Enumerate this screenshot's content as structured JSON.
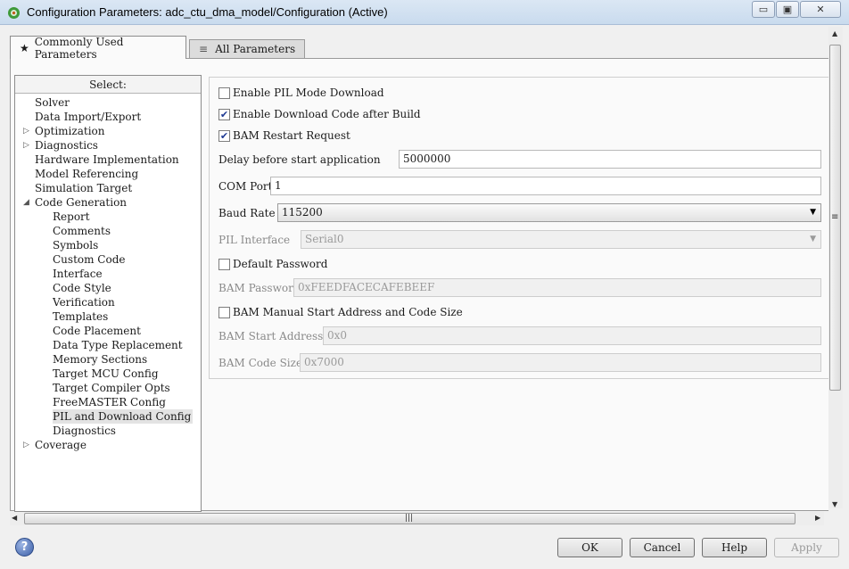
{
  "window": {
    "title": "Configuration Parameters: adc_ctu_dma_model/Configuration (Active)",
    "minimize": "▭",
    "maximize": "▣",
    "close": "✕"
  },
  "tabs": [
    {
      "icon": "★",
      "label": "Commonly Used Parameters"
    },
    {
      "icon": "≡",
      "label": "All Parameters"
    }
  ],
  "tree": {
    "header": "Select:",
    "items": [
      {
        "label": "Solver",
        "level": 0
      },
      {
        "label": "Data Import/Export",
        "level": 0
      },
      {
        "label": "Optimization",
        "level": 0,
        "expander": "▷"
      },
      {
        "label": "Diagnostics",
        "level": 0,
        "expander": "▷"
      },
      {
        "label": "Hardware Implementation",
        "level": 0
      },
      {
        "label": "Model Referencing",
        "level": 0
      },
      {
        "label": "Simulation Target",
        "level": 0
      },
      {
        "label": "Code Generation",
        "level": 0,
        "expander": "◢"
      },
      {
        "label": "Report",
        "level": 1
      },
      {
        "label": "Comments",
        "level": 1
      },
      {
        "label": "Symbols",
        "level": 1
      },
      {
        "label": "Custom Code",
        "level": 1
      },
      {
        "label": "Interface",
        "level": 1
      },
      {
        "label": "Code Style",
        "level": 1
      },
      {
        "label": "Verification",
        "level": 1
      },
      {
        "label": "Templates",
        "level": 1
      },
      {
        "label": "Code Placement",
        "level": 1
      },
      {
        "label": "Data Type Replacement",
        "level": 1
      },
      {
        "label": "Memory Sections",
        "level": 1
      },
      {
        "label": "Target MCU Config",
        "level": 1
      },
      {
        "label": "Target Compiler Opts",
        "level": 1
      },
      {
        "label": "FreeMASTER Config",
        "level": 1
      },
      {
        "label": "PIL and Download Config",
        "level": 1,
        "selected": true
      },
      {
        "label": "Diagnostics",
        "level": 1
      },
      {
        "label": "Coverage",
        "level": 0,
        "expander": "▷"
      }
    ]
  },
  "settings": {
    "enable_pil": {
      "label": "Enable PIL Mode Download",
      "checked": false
    },
    "enable_download": {
      "label": "Enable Download Code after Build",
      "checked": true
    },
    "bam_restart": {
      "label": "BAM Restart Request",
      "checked": true
    },
    "delay": {
      "label": "Delay before start application",
      "value": "5000000"
    },
    "com_port": {
      "label": "COM Port",
      "value": "1"
    },
    "baud_rate": {
      "label": "Baud Rate",
      "value": "115200"
    },
    "pil_interface": {
      "label": "PIL Interface",
      "value": "Serial0"
    },
    "default_password": {
      "label": "Default Password",
      "checked": false
    },
    "bam_password": {
      "label": "BAM Password",
      "value": "0xFEEDFACECAFEBEEF"
    },
    "bam_manual": {
      "label": "BAM Manual Start Address and Code Size",
      "checked": false
    },
    "bam_start": {
      "label": "BAM Start Address",
      "value": "0x0"
    },
    "bam_code_size": {
      "label": "BAM Code Size",
      "value": "0x7000"
    }
  },
  "buttons": {
    "help": "?",
    "ok": "OK",
    "cancel": "Cancel",
    "help_btn": "Help",
    "apply": "Apply"
  },
  "scroll": {
    "grip_h": "|||",
    "grip_v": "≡"
  },
  "colors": {
    "accent": "#1f3a93",
    "selection": "#e3e3e3",
    "panel": "#fafafa"
  }
}
